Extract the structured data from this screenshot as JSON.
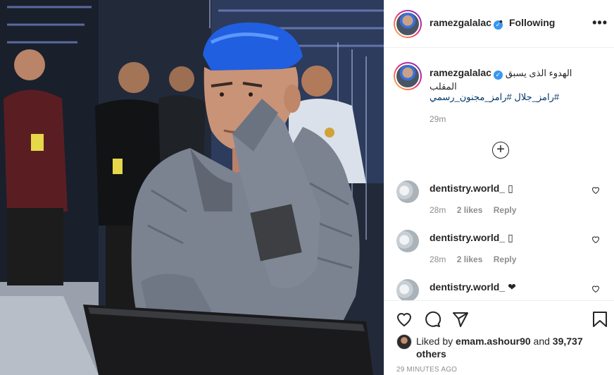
{
  "post": {
    "username": "ramezgalalac",
    "follow_status": "Following",
    "more_label": "•••",
    "caption": {
      "text": "الهدوء الذى يسبق المقلب",
      "hashtags": "#رامز_جلال #رامز_مجنون_رسمي",
      "time": "29m"
    },
    "load_more_label": "+",
    "comments": [
      {
        "username": "dentistry.world_",
        "text": "▯",
        "time": "28m",
        "likes": "2 likes",
        "reply": "Reply"
      },
      {
        "username": "dentistry.world_",
        "text": "▯",
        "time": "28m",
        "likes": "2 likes",
        "reply": "Reply"
      },
      {
        "username": "dentistry.world_",
        "text": "❤",
        "time": "",
        "likes": "",
        "reply": ""
      }
    ],
    "liked_by": {
      "prefix": "Liked by",
      "user": "emam.ashour90",
      "conjunction": "and",
      "others": "39,737 others"
    },
    "time_ago": "29 MINUTES AGO"
  },
  "icons": {
    "verified": "verified-badge-icon",
    "like": "heart-icon",
    "comment": "comment-bubble-icon",
    "share": "paper-plane-icon",
    "save": "bookmark-icon",
    "load_more": "plus-circle-icon"
  },
  "colors": {
    "verified": "#3897f0",
    "text": "#262626",
    "muted": "#8e8e8e",
    "hashtag": "#00376b",
    "hair": "#1f5fe0"
  }
}
